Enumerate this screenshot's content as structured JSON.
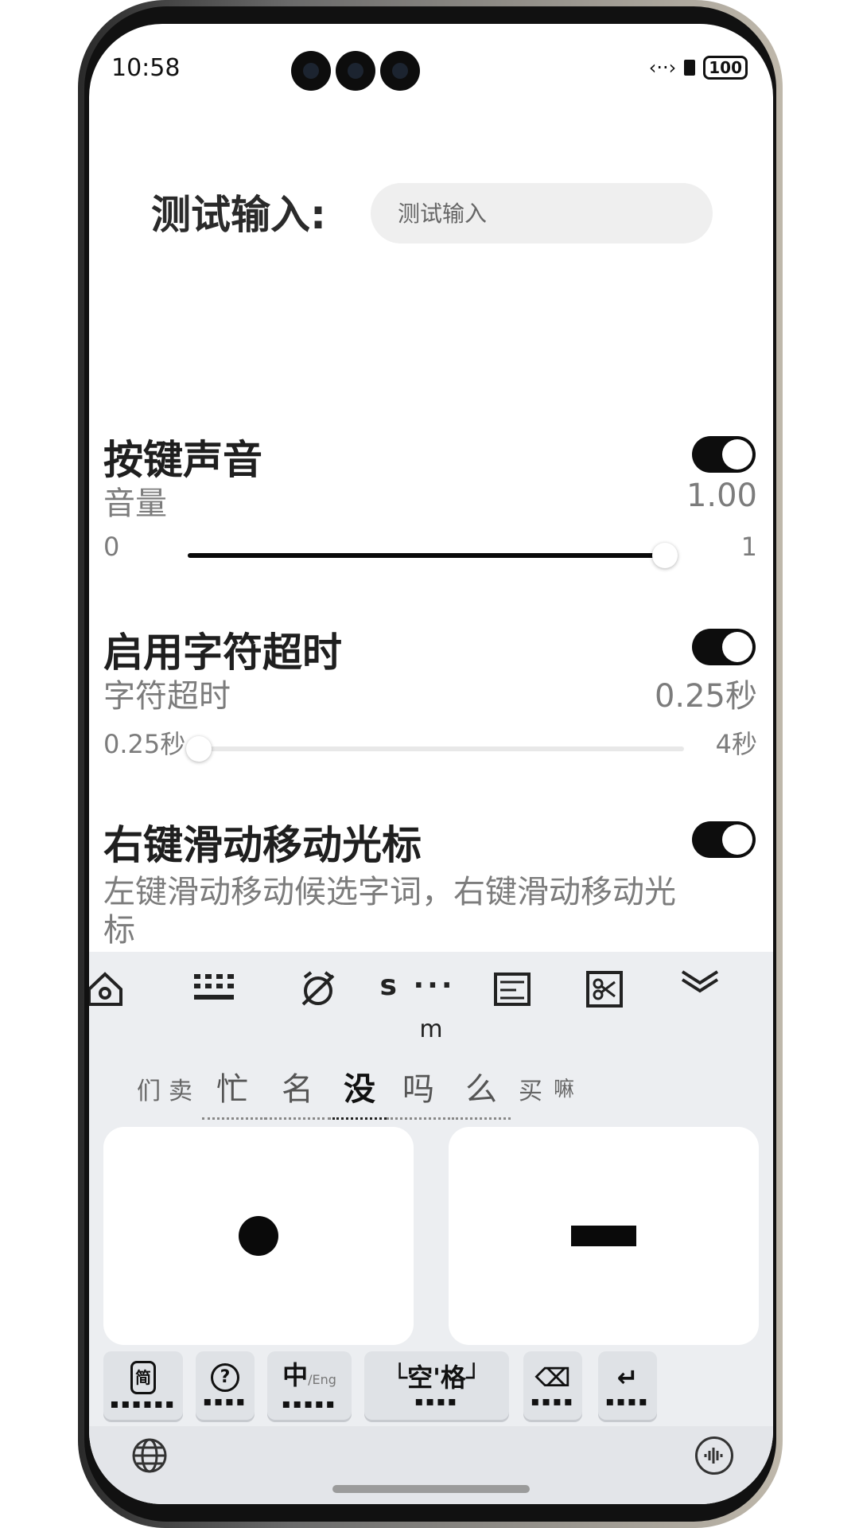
{
  "status": {
    "time": "10:58",
    "net": "‹··›",
    "battery": "100"
  },
  "test": {
    "label": "测试输入:",
    "placeholder": "测试输入"
  },
  "keysound": {
    "title": "按键声音",
    "sub": "音量",
    "value": "1.00",
    "min": "0",
    "max": "1",
    "level": 1.0,
    "enabled": true
  },
  "timeout": {
    "title": "启用字符超时",
    "sub": "字符超时",
    "value": "0.25秒",
    "min": "0.25秒",
    "max": "4秒",
    "level": 0.0,
    "enabled": true
  },
  "swipe": {
    "title": "右键滑动移动光标",
    "desc_1": "左键滑动移动候选字词，右键滑动移动光",
    "desc_2": "标",
    "enabled": true
  },
  "keyboard": {
    "toolbar_text": "s ···",
    "pinyin": "m",
    "candidates": [
      "们",
      "卖",
      "忙",
      "名",
      "没",
      "吗",
      "么",
      "买",
      "嘛"
    ],
    "selected_candidate": "没",
    "function_keys": {
      "lang_main": "中",
      "lang_sub": "/Eng",
      "space": "└空'格┘",
      "help": "?",
      "symbol": "简",
      "backspace": "⌫",
      "enter": "↵"
    },
    "icons": [
      "home-gear-icon",
      "keyboard-grid-icon",
      "alarm-off-icon",
      "text-editor-icon",
      "scissors-icon",
      "collapse-keyboard-icon",
      "globe-icon",
      "voice-icon"
    ]
  }
}
